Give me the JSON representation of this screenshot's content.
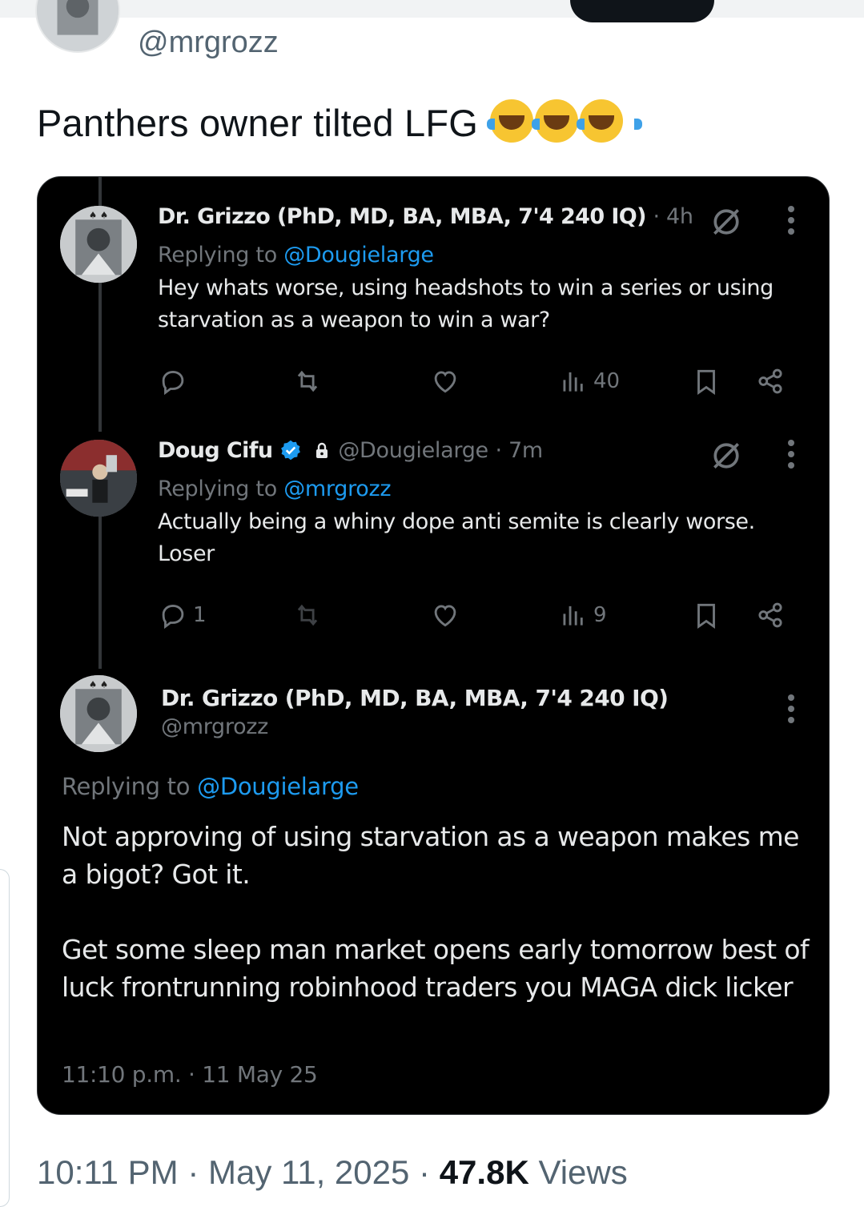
{
  "top": {
    "handle": "@mrgrozz",
    "text": "Panthers owner tilted LFG"
  },
  "emoji_icons": [
    "face-with-tears-of-joy-icon",
    "face-with-tears-of-joy-icon",
    "face-with-tears-of-joy-icon"
  ],
  "quoted": {
    "tweet1": {
      "name": "Dr. Grizzo (PhD, MD, BA, MBA, 7'4 240 IQ)",
      "time": "· 4h",
      "replying_prefix": "Replying to",
      "replying_handle": "@Dougielarge",
      "text": "Hey whats worse, using headshots to win a series or using starvation as a weapon to win a war?",
      "views": "40",
      "replies": "",
      "icons": [
        "reply-icon",
        "retweet-icon",
        "like-icon",
        "views-icon",
        "bookmark-icon",
        "share-icon",
        "grok-icon",
        "more-icon"
      ]
    },
    "tweet2": {
      "name": "Doug Cifu",
      "handle": "@Dougielarge",
      "time": "· 7m",
      "replying_prefix": "Replying to",
      "replying_handle": "@mrgrozz",
      "text_line1": "Actually being a whiny dope anti semite is clearly worse.",
      "text_line2": "Loser",
      "replies": "1",
      "views": "9",
      "icons": [
        "verified-badge-icon",
        "lock-icon",
        "grok-icon",
        "more-icon"
      ]
    },
    "tweet3": {
      "name": "Dr. Grizzo (PhD, MD, BA, MBA, 7'4 240 IQ)",
      "handle": "@mrgrozz",
      "replying_prefix": "Replying to",
      "replying_handle": "@Dougielarge",
      "para1": "Not approving of using starvation as a weapon makes me a bigot? Got it.",
      "para2": "Get some sleep man market opens early tomorrow best of luck frontrunning robinhood traders you MAGA dick licker",
      "timestamp": "11:10 p.m. · 11 May 25"
    }
  },
  "footer": {
    "time": "10:11 PM · May 11, 2025 ·",
    "views_count": "47.8K",
    "views_label": "Views"
  },
  "colors": {
    "link": "#1d9bf0",
    "dim": "#71767b",
    "card_bg": "#000000",
    "verified": "#1d9bf0"
  }
}
